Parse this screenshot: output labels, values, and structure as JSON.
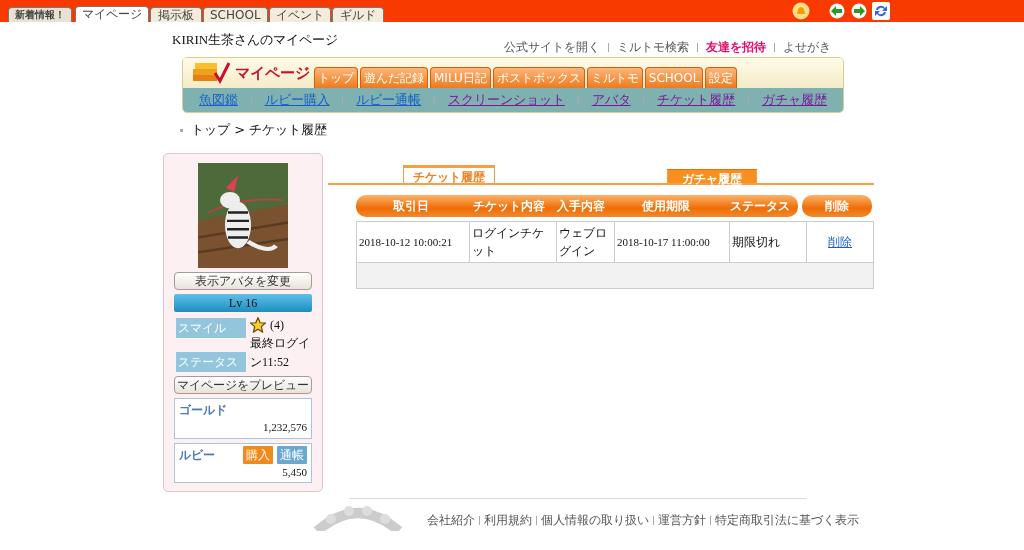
{
  "top_tabs": [
    {
      "label": "新着情報！",
      "kind": "news",
      "selected": false
    },
    {
      "label": "マイページ",
      "kind": "tab",
      "selected": true
    },
    {
      "label": "掲示板",
      "kind": "tab",
      "selected": false
    },
    {
      "label": "SCHOOL",
      "kind": "tab",
      "selected": false
    },
    {
      "label": "イベント",
      "kind": "tab",
      "selected": false
    },
    {
      "label": "ギルド",
      "kind": "tab",
      "selected": false
    }
  ],
  "page_title": "KIRIN生茶さんのマイページ",
  "header_links": [
    {
      "label": "公式サイトを開く",
      "highlighted": false
    },
    {
      "label": "ミルトモ検索",
      "highlighted": false
    },
    {
      "label": "友達を招待",
      "highlighted": true
    },
    {
      "label": "よせがき",
      "highlighted": false
    }
  ],
  "banner": {
    "title": "マイページ",
    "tabs": [
      "トップ",
      "遊んだ記録",
      "MILU日記",
      "ポストボックス",
      "ミルトモ",
      "SCHOOL",
      "設定"
    ]
  },
  "nav_links": [
    {
      "label": "魚図鑑",
      "visited": false
    },
    {
      "label": "ルビー購入",
      "visited": false
    },
    {
      "label": "ルビー通帳",
      "visited": false
    },
    {
      "label": "スクリーンショット",
      "visited": true
    },
    {
      "label": "アバタ",
      "visited": true
    },
    {
      "label": "チケット履歴",
      "visited": true
    },
    {
      "label": "ガチャ履歴",
      "visited": true
    }
  ],
  "breadcrumb": "トップ > チケット履歴",
  "profile": {
    "change_avatar": "表示アバタを変更",
    "level": "Lv 16",
    "smile_label": "スマイル",
    "smile_count": "(4)",
    "status_label": "ステータス",
    "last_login": "最終ログイン11:52",
    "preview": "マイページをプレビュー",
    "gold_label": "ゴールド",
    "gold": "1,232,576",
    "ruby_label": "ルビー",
    "ruby_buy": "購入",
    "ruby_book": "通帳",
    "ruby": "5,450"
  },
  "history_tabs": [
    {
      "label": "チケット履歴",
      "selected": true
    },
    {
      "label": "ガチャ履歴",
      "selected": false
    }
  ],
  "table": {
    "columns": [
      "取引日",
      "チケット内容",
      "入手内容",
      "使用期限",
      "ステータス"
    ],
    "delete_column": "削除",
    "rows": [
      {
        "cells": [
          "2018-10-12 10:00:21",
          "ログインチケット",
          "ウェブログイン",
          "2018-10-17 11:00:00",
          "期限切れ"
        ],
        "action": "削除"
      }
    ]
  },
  "footer_links": [
    "会社紹介",
    "利用規約",
    "個人情報の取り扱い",
    "運営方針",
    "特定商取引法に基づく表示"
  ]
}
